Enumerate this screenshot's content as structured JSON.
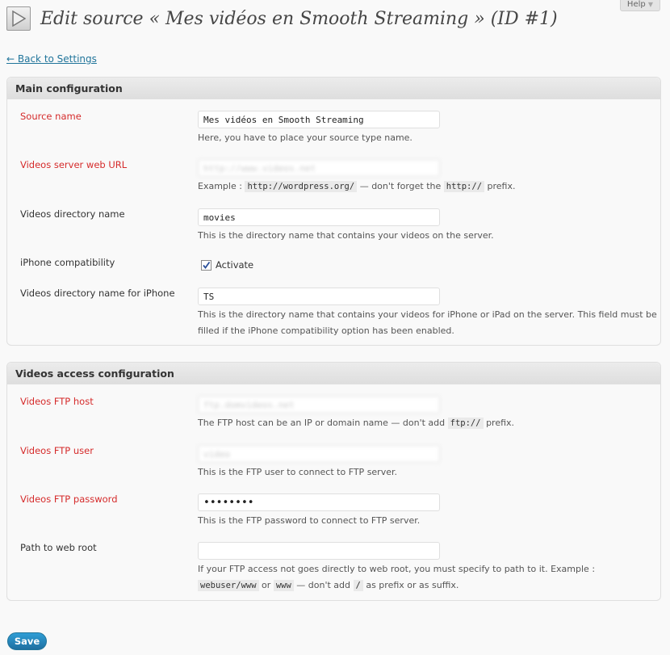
{
  "help": {
    "label": "Help"
  },
  "header": {
    "title": "Edit source « Mes vidéos en Smooth Streaming » (ID #1)"
  },
  "back_link": "← Back to Settings",
  "main_config": {
    "title": "Main configuration",
    "source_name": {
      "label": "Source name",
      "value": "Mes vidéos en Smooth Streaming",
      "desc": "Here, you have to place your source type name."
    },
    "server_url": {
      "label": "Videos server web URL",
      "value": "http://www.videos.net",
      "desc_pre": "Example :",
      "desc_code1": "http://wordpress.org/",
      "desc_mid": "— don't forget the",
      "desc_code2": "http://",
      "desc_post": "prefix."
    },
    "dir_name": {
      "label": "Videos directory name",
      "value": "movies",
      "desc": "This is the directory name that contains your videos on the server."
    },
    "iphone": {
      "label": "iPhone compatibility",
      "checkbox_label": "Activate",
      "checked": true
    },
    "iphone_dir": {
      "label": "Videos directory name for iPhone",
      "value": "TS",
      "desc": "This is the directory name that contains your videos for iPhone or iPad on the server. This field must be filled if the iPhone compatibility option has been enabled."
    }
  },
  "access_config": {
    "title": "Videos access configuration",
    "ftp_host": {
      "label": "Videos FTP host",
      "value": "ftp.domvideos.net",
      "desc_pre": "The FTP host can be an IP or domain name — don't add",
      "desc_code": "ftp://",
      "desc_post": "prefix."
    },
    "ftp_user": {
      "label": "Videos FTP user",
      "value": "video",
      "desc": "This is the FTP user to connect to FTP server."
    },
    "ftp_password": {
      "label": "Videos FTP password",
      "value": "••••••••",
      "desc": "This is the FTP password to connect to FTP server."
    },
    "web_root": {
      "label": "Path to web root",
      "value": "",
      "desc_pre": "If your FTP access not goes directly to web root, you must specify to path to it. Example :",
      "desc_code1": "webuser/www",
      "desc_or": "or",
      "desc_code2": "www",
      "desc_mid": "— don't add",
      "desc_code3": "/",
      "desc_post": "as prefix or as suffix."
    }
  },
  "save_label": "Save"
}
